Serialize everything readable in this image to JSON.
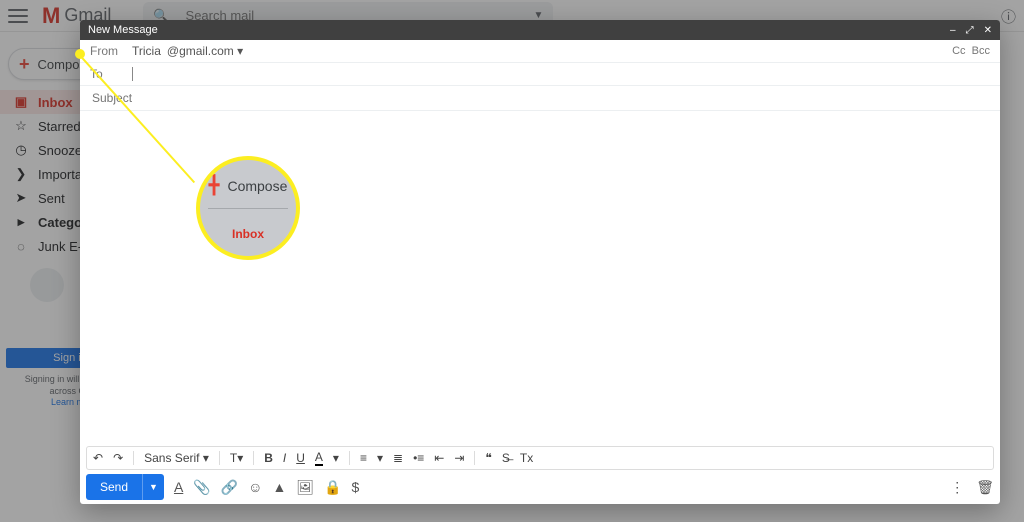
{
  "header": {
    "app_name": "Gmail",
    "search_placeholder": "Search mail"
  },
  "sidebar": {
    "compose_label": "Compose",
    "items": [
      {
        "icon": "inbox",
        "label": "Inbox"
      },
      {
        "icon": "star",
        "label": "Starred"
      },
      {
        "icon": "clock",
        "label": "Snoozed"
      },
      {
        "icon": "important",
        "label": "Important"
      },
      {
        "icon": "sent",
        "label": "Sent"
      },
      {
        "icon": "categories",
        "label": "Categories"
      },
      {
        "icon": "junk",
        "label": "Junk E-mail"
      }
    ],
    "signin_button": "Sign in",
    "signin_note_line1": "Signing in will sign you",
    "signin_note_line2": "across Go",
    "learn_more": "Learn mo"
  },
  "compose": {
    "title": "New Message",
    "from_label": "From",
    "from_name": "Tricia",
    "from_email": "@gmail.com",
    "to_label": "To",
    "cc_label": "Cc",
    "bcc_label": "Bcc",
    "subject_placeholder": "Subject",
    "font_family": "Sans Serif",
    "send_label": "Send"
  },
  "callout": {
    "compose_label": "Compose",
    "inbox_label": "Inbox"
  },
  "icons": {
    "undo": "↶",
    "redo": "↷",
    "font_size": "T",
    "bold": "B",
    "italic": "I",
    "underline": "U",
    "text_color": "A",
    "align": "≡",
    "list_num": "≣",
    "list_bul": "•≡",
    "indent_dec": "⇤",
    "indent_inc": "⇥",
    "quote": "❝",
    "strike": "S̶",
    "clear": "Tx",
    "fmt": "A",
    "attach": "📎",
    "link": "🔗",
    "emoji": "☺",
    "drive": "▲",
    "photo": "🖼",
    "lock": "🔒",
    "money": "$",
    "more": "⋮",
    "trash": "🗑",
    "minimize": "–",
    "expand": "⤢",
    "close": "✕"
  }
}
